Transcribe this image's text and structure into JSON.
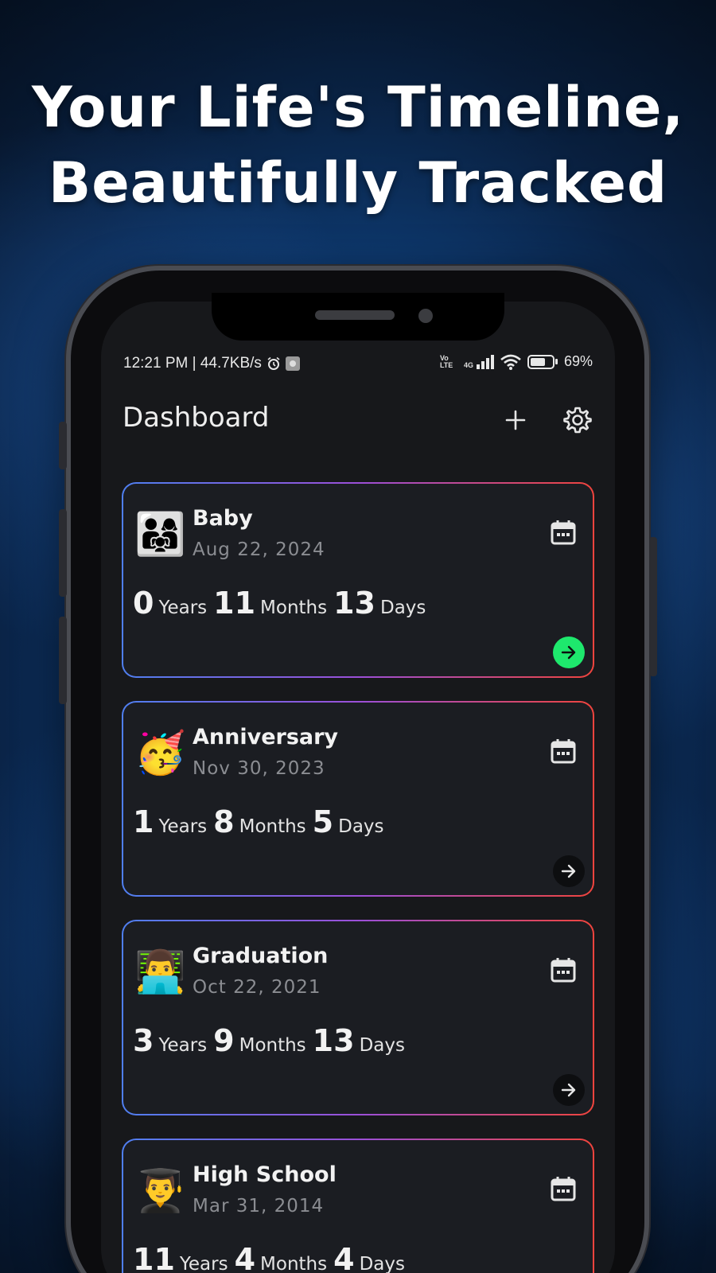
{
  "headline": {
    "line1": "Your Life's Timeline,",
    "line2": "Beautifully Tracked"
  },
  "status_bar": {
    "left_text": "12:21 PM | 44.7KB/s",
    "volte": "Vo LTE",
    "network": "4G",
    "battery": "69%"
  },
  "app_bar": {
    "title": "Dashboard"
  },
  "units": {
    "years": "Years",
    "months": "Months",
    "days": "Days"
  },
  "cards": [
    {
      "emoji": "👨‍👩‍👧",
      "title": "Baby",
      "date": "Aug 22, 2024",
      "years": "0",
      "months": "11",
      "days": "13",
      "active": true
    },
    {
      "emoji": "🥳",
      "title": "Anniversary",
      "date": "Nov 30, 2023",
      "years": "1",
      "months": "8",
      "days": "5",
      "active": false
    },
    {
      "emoji": "👨‍💻",
      "title": "Graduation",
      "date": "Oct 22, 2021",
      "years": "3",
      "months": "9",
      "days": "13",
      "active": false
    },
    {
      "emoji": "👨‍🎓",
      "title": "High School",
      "date": "Mar 31, 2014",
      "years": "11",
      "months": "4",
      "days": "4",
      "active": false
    }
  ],
  "colors": {
    "card_border_start": "#4f7ff0",
    "card_border_mid": "#9b4fd8",
    "card_border_end": "#f0443d",
    "active_arrow": "#1ee86d"
  }
}
